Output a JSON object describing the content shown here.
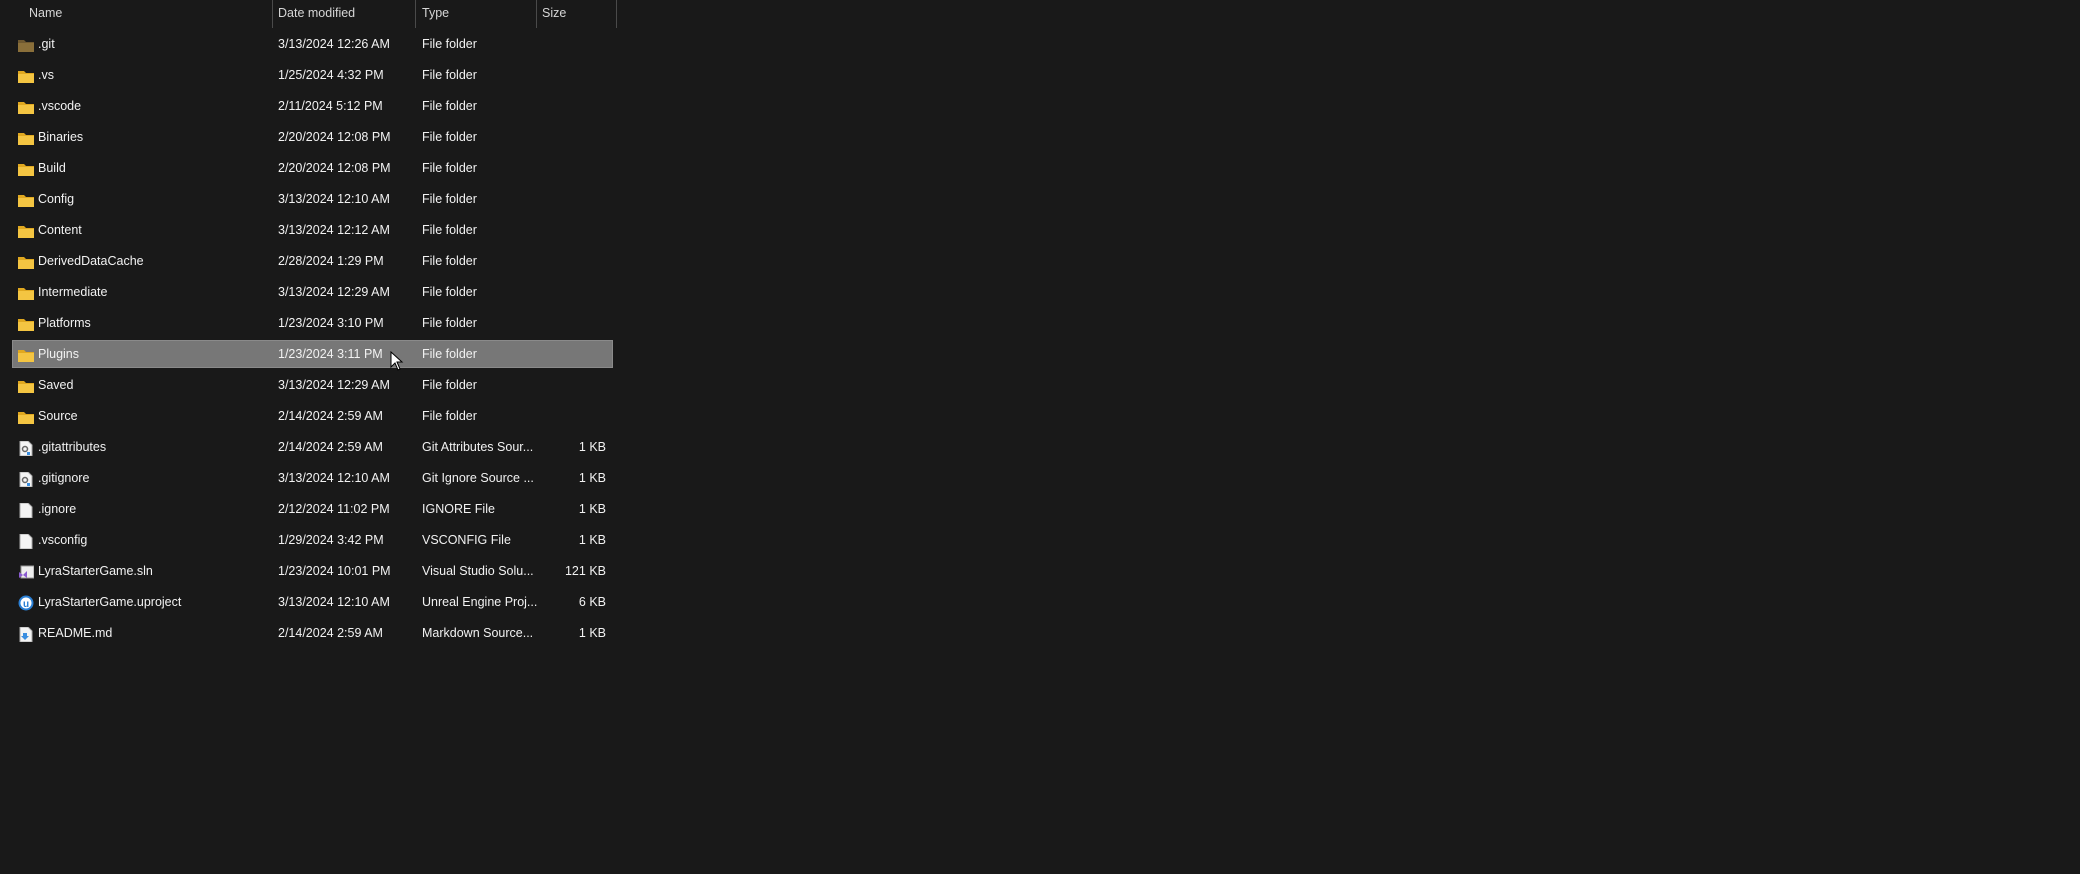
{
  "columns": {
    "name": "Name",
    "date": "Date modified",
    "type": "Type",
    "size": "Size"
  },
  "selected_index": 10,
  "colors": {
    "folder": "#f4c542",
    "git_folder": "#8a6f3a",
    "selection": "#777777",
    "background": "#191919"
  },
  "files": [
    {
      "name": ".git",
      "date": "3/13/2024 12:26 AM",
      "type": "File folder",
      "size": "",
      "icon": "git-folder-icon"
    },
    {
      "name": ".vs",
      "date": "1/25/2024 4:32 PM",
      "type": "File folder",
      "size": "",
      "icon": "folder-icon"
    },
    {
      "name": ".vscode",
      "date": "2/11/2024 5:12 PM",
      "type": "File folder",
      "size": "",
      "icon": "folder-icon"
    },
    {
      "name": "Binaries",
      "date": "2/20/2024 12:08 PM",
      "type": "File folder",
      "size": "",
      "icon": "folder-icon"
    },
    {
      "name": "Build",
      "date": "2/20/2024 12:08 PM",
      "type": "File folder",
      "size": "",
      "icon": "folder-icon"
    },
    {
      "name": "Config",
      "date": "3/13/2024 12:10 AM",
      "type": "File folder",
      "size": "",
      "icon": "folder-icon"
    },
    {
      "name": "Content",
      "date": "3/13/2024 12:12 AM",
      "type": "File folder",
      "size": "",
      "icon": "folder-icon"
    },
    {
      "name": "DerivedDataCache",
      "date": "2/28/2024 1:29 PM",
      "type": "File folder",
      "size": "",
      "icon": "folder-icon"
    },
    {
      "name": "Intermediate",
      "date": "3/13/2024 12:29 AM",
      "type": "File folder",
      "size": "",
      "icon": "folder-icon"
    },
    {
      "name": "Platforms",
      "date": "1/23/2024 3:10 PM",
      "type": "File folder",
      "size": "",
      "icon": "folder-icon"
    },
    {
      "name": "Plugins",
      "date": "1/23/2024 3:11 PM",
      "type": "File folder",
      "size": "",
      "icon": "folder-icon"
    },
    {
      "name": "Saved",
      "date": "3/13/2024 12:29 AM",
      "type": "File folder",
      "size": "",
      "icon": "folder-icon"
    },
    {
      "name": "Source",
      "date": "2/14/2024 2:59 AM",
      "type": "File folder",
      "size": "",
      "icon": "folder-icon"
    },
    {
      "name": ".gitattributes",
      "date": "2/14/2024 2:59 AM",
      "type": "Git Attributes Sour...",
      "size": "1 KB",
      "icon": "settings-file-icon"
    },
    {
      "name": ".gitignore",
      "date": "3/13/2024 12:10 AM",
      "type": "Git Ignore Source ...",
      "size": "1 KB",
      "icon": "settings-file-icon"
    },
    {
      "name": ".ignore",
      "date": "2/12/2024 11:02 PM",
      "type": "IGNORE File",
      "size": "1 KB",
      "icon": "blank-file-icon"
    },
    {
      "name": ".vsconfig",
      "date": "1/29/2024 3:42 PM",
      "type": "VSCONFIG File",
      "size": "1 KB",
      "icon": "blank-file-icon"
    },
    {
      "name": "LyraStarterGame.sln",
      "date": "1/23/2024 10:01 PM",
      "type": "Visual Studio Solu...",
      "size": "121 KB",
      "icon": "visual-studio-solution-icon"
    },
    {
      "name": "LyraStarterGame.uproject",
      "date": "3/13/2024 12:10 AM",
      "type": "Unreal Engine Proj...",
      "size": "6 KB",
      "icon": "unreal-engine-icon"
    },
    {
      "name": "README.md",
      "date": "2/14/2024 2:59 AM",
      "type": "Markdown Source...",
      "size": "1 KB",
      "icon": "markdown-file-icon"
    }
  ]
}
